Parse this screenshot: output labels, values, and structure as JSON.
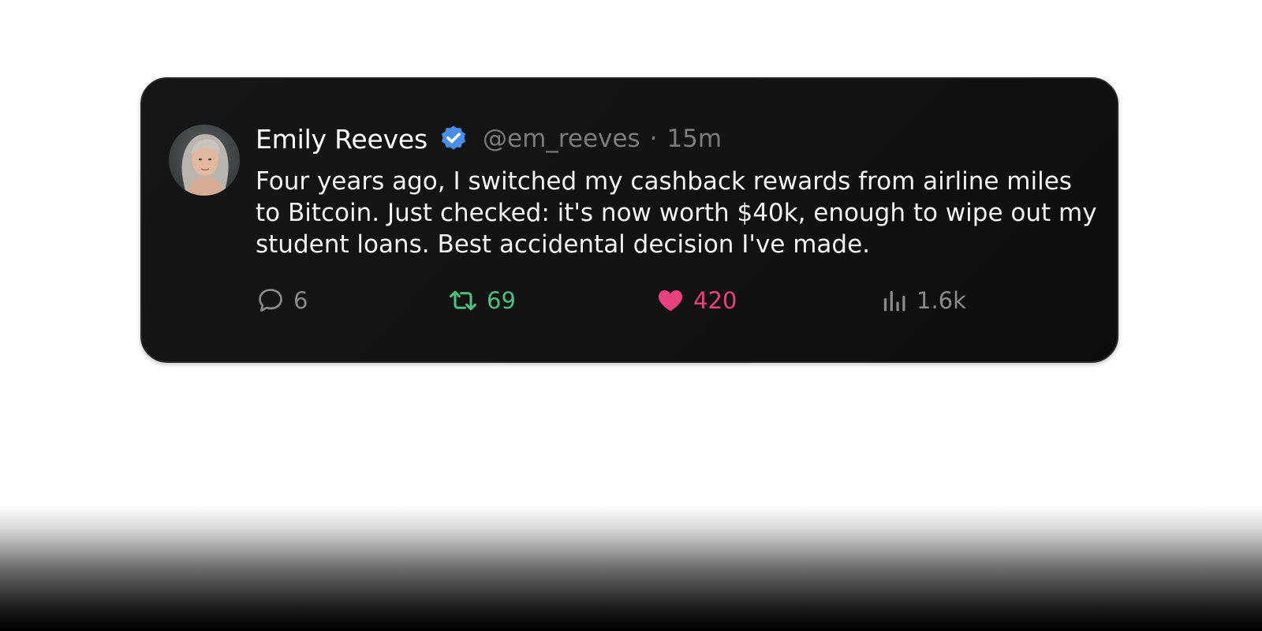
{
  "tweet": {
    "author": {
      "name": "Emily Reeves",
      "handle": "@em_reeves",
      "verified": true
    },
    "separator": "·",
    "time": "15m",
    "text": "Four years ago, I switched my cashback rewards from airline miles to Bitcoin. Just checked: it's now worth $40k, enough to wipe out my student loans. Best accidental decision I've made.",
    "actions": {
      "replies": "6",
      "retweets": "69",
      "likes": "420",
      "views": "1.6k"
    }
  },
  "colors": {
    "card_background": "#131313",
    "verified_blue": "#4a8fe7",
    "retweet_green": "#4fbf7f",
    "like_pink": "#e8417f",
    "muted_gray": "#7c7c7c"
  },
  "icons": {
    "reply": "speech-bubble-icon",
    "retweet": "retweet-arrows-icon",
    "like": "heart-icon",
    "views": "bar-chart-icon",
    "verified": "verified-badge-icon"
  }
}
